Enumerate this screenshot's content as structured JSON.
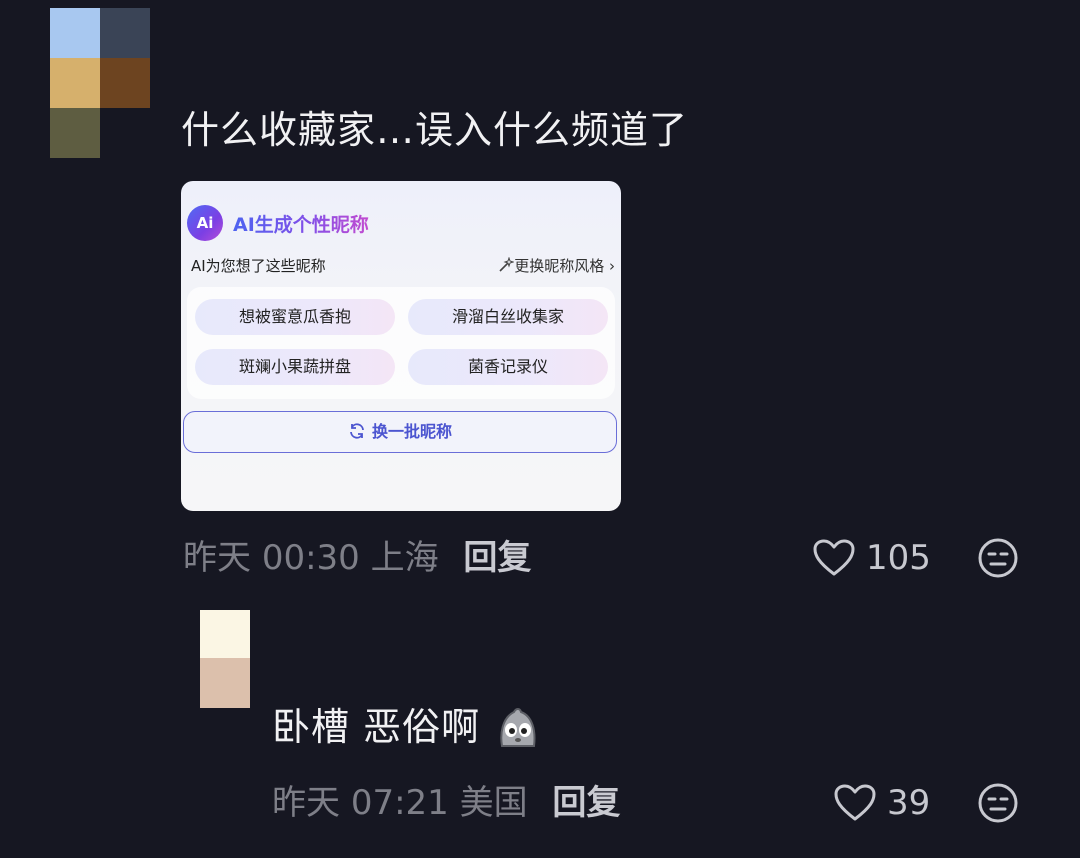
{
  "comment1": {
    "avatar_pixels": [
      "#a8c8f0",
      "#3a4456",
      "#d6b06c",
      "#6d4420",
      "#5e5d41",
      "#161722"
    ],
    "text": "什么收藏家…误入什么频道了",
    "image": {
      "logo_text": "Ai",
      "title": "AI生成个性昵称",
      "subtitle": "AI为您想了这些昵称",
      "change_style": "更换昵称风格",
      "chevron": "›",
      "nicknames": [
        "想被蜜意瓜香抱",
        "滑溜白丝收集家",
        "斑斓小果蔬拼盘",
        "菌香记录仪"
      ],
      "refresh_button": "换一批昵称"
    },
    "time": "昨天",
    "clock": "00:30",
    "location": "上海",
    "reply": "回复",
    "likes": "105"
  },
  "reply1": {
    "avatar_pixels": [
      "#fbf6e4",
      "#dcc0ac"
    ],
    "text": "卧槽 恶俗啊",
    "time": "昨天",
    "clock": "07:21",
    "location": "美国",
    "reply": "回复",
    "likes": "39"
  },
  "icons": {
    "heart": "heart-icon",
    "more": "meh-face-icon",
    "emoji": "sad-ghost-emoji"
  }
}
